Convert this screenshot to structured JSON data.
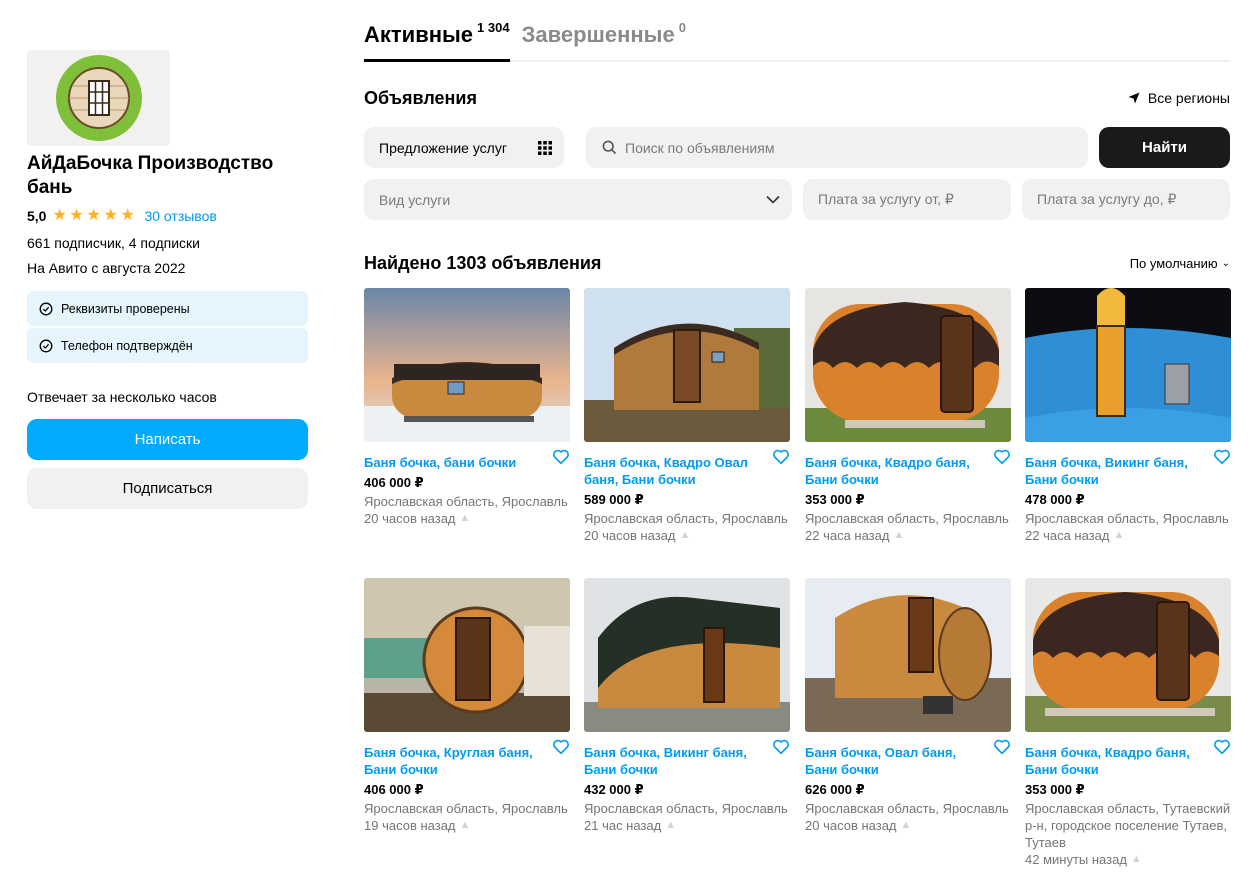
{
  "seller": {
    "name": "АйДаБочка Производство бань",
    "rating": "5,0",
    "reviews": "30 отзывов",
    "subscribers": "661 подписчик, 4 подписки",
    "since": "На Авито с августа 2022",
    "badges": [
      "Реквизиты проверены",
      "Телефон подтверждён"
    ],
    "reply_time": "Отвечает за несколько часов",
    "write_button": "Написать",
    "subscribe_button": "Подписаться",
    "accent": "#00aaff"
  },
  "tabs": [
    {
      "label": "Активные",
      "count": "1 304"
    },
    {
      "label": "Завершенные",
      "count": "0"
    }
  ],
  "listings": {
    "title": "Объявления",
    "region": "Все регионы",
    "category_select": "Предложение услуг",
    "search_placeholder": "Поиск по объявлениям",
    "find_button": "Найти",
    "service_type_placeholder": "Вид услуги",
    "price_from_placeholder": "Плата за услугу от, ₽",
    "price_to_placeholder": "Плата за услугу до, ₽",
    "found": "Найдено 1303 объявления",
    "sort": "По умолчанию"
  },
  "cards": [
    {
      "title": "Баня бочка, бани бочки",
      "price": "406 000 ₽",
      "location": "Ярославская область, Ярославль",
      "time": "20 часов назад"
    },
    {
      "title": "Баня бочка, Квадро Овал баня, Бани бочки",
      "price": "589 000 ₽",
      "location": "Ярославская область, Ярославль",
      "time": "20 часов назад"
    },
    {
      "title": "Баня бочка, Квадро баня, Бани бочки",
      "price": "353 000 ₽",
      "location": "Ярославская область, Ярославль",
      "time": "22 часа назад"
    },
    {
      "title": "Баня бочка, Викинг баня, Бани бочки",
      "price": "478 000 ₽",
      "location": "Ярославская область, Ярославль",
      "time": "22 часа назад"
    },
    {
      "title": "Баня бочка, Круглая баня, Бани бочки",
      "price": "406 000 ₽",
      "location": "Ярославская область, Ярославль",
      "time": "19 часов назад"
    },
    {
      "title": "Баня бочка, Викинг баня, Бани бочки",
      "price": "432 000 ₽",
      "location": "Ярославская область, Ярославль",
      "time": "21 час назад"
    },
    {
      "title": "Баня бочка, Овал баня, Бани бочки",
      "price": "626 000 ₽",
      "location": "Ярославская область, Ярославль",
      "time": "20 часов назад"
    },
    {
      "title": "Баня бочка, Квадро баня, Бани бочки",
      "price": "353 000 ₽",
      "location": "Ярославская область, Тутаевский р-н, городское поселение Тутаев, Тутаев",
      "time": "42 минуты назад"
    }
  ]
}
